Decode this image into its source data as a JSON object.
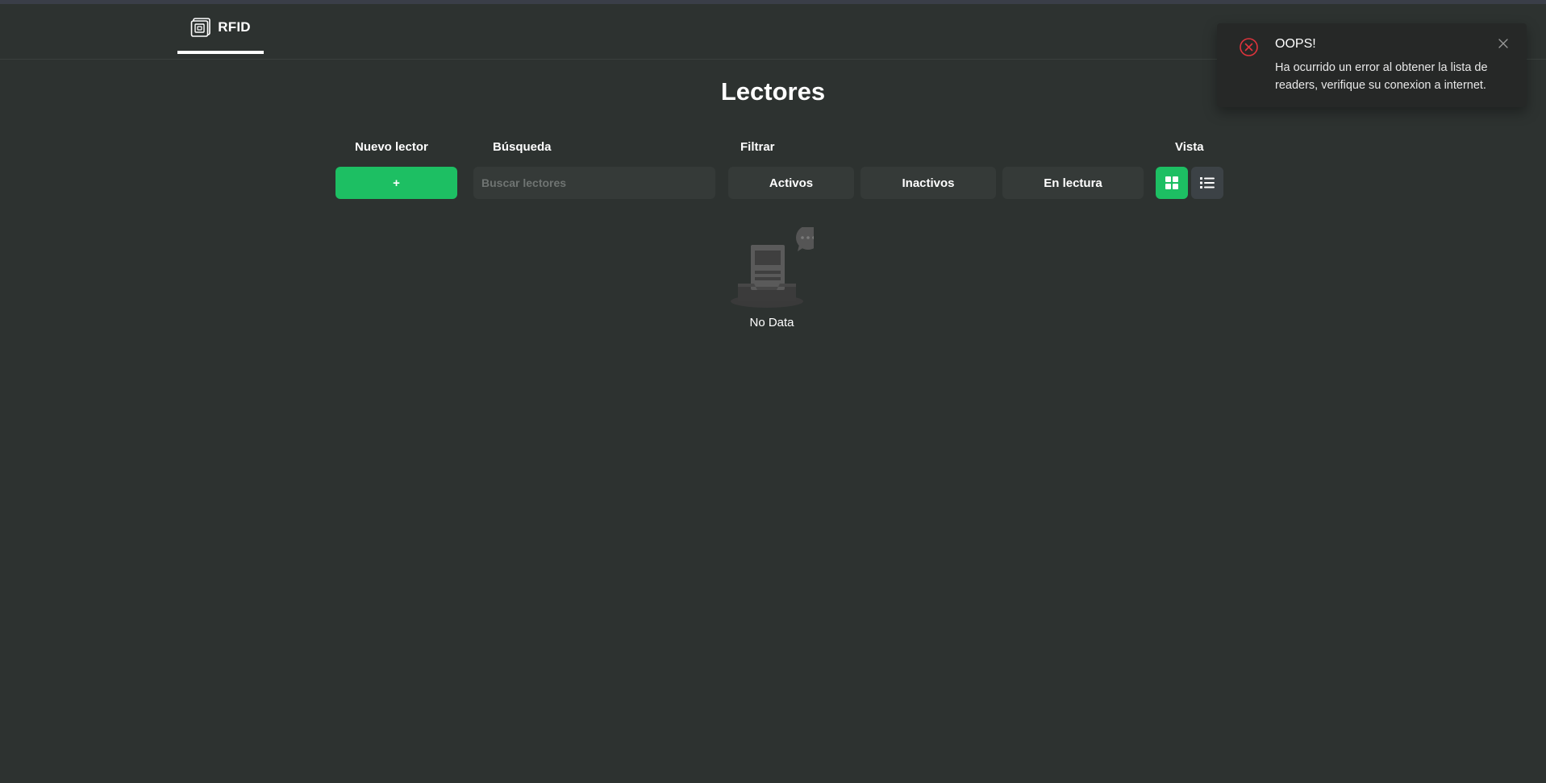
{
  "nav": {
    "tab_label": "RFID",
    "logo_icon": "rfid-chip-icon"
  },
  "page": {
    "title": "Lectores"
  },
  "toolbar": {
    "new_label": "Nuevo lector",
    "new_button": "+",
    "search_label": "Búsqueda",
    "search_placeholder": "Buscar lectores",
    "search_value": "",
    "filter_label": "Filtrar",
    "filters": [
      "Activos",
      "Inactivos",
      "En lectura"
    ],
    "view_label": "Vista",
    "view_modes": [
      "grid-icon",
      "list-icon"
    ],
    "active_view": "grid"
  },
  "empty": {
    "text": "No Data",
    "icon": "empty-inbox-icon"
  },
  "toast": {
    "title": "OOPS!",
    "message": "Ha ocurrido un error al obtener la lista de readers, verifique su conexion a internet.",
    "icon": "error-circle-icon",
    "close_icon": "close-icon"
  },
  "colors": {
    "background": "#2d3230",
    "accent": "#1dbf63",
    "error": "#e0343c",
    "surface": "#353a38"
  }
}
